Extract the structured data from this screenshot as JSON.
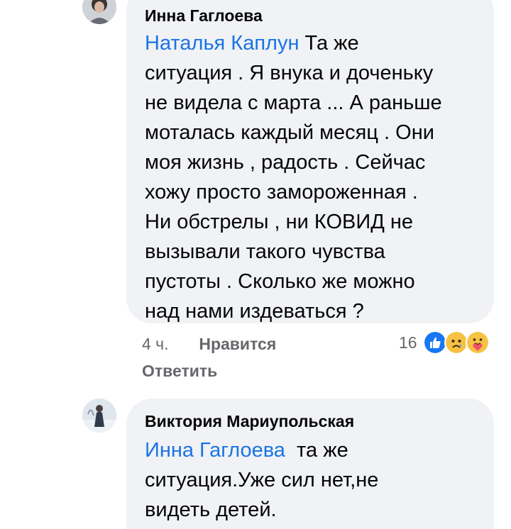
{
  "comments": [
    {
      "author": "Инна Гаглоева",
      "mention": "Наталья Каплун",
      "lines": [
        "Та же",
        "ситуация . Я внука и доченьку",
        "не видела с марта ... А раньше",
        "моталась каждый месяц . Они",
        "моя жизнь , радость . Сейчас",
        "хожу просто замороженная .",
        "Ни обстрелы , ни КОВИД не",
        "вызывали такого чувства",
        "пустоты . Сколько же можно",
        "над нами издеваться ?"
      ],
      "time": "4 ч.",
      "like_label": "Нравится",
      "reply_label": "Ответить",
      "reaction_count": "16",
      "reactions": [
        "like-icon",
        "sad-icon",
        "care-icon"
      ]
    },
    {
      "author": "Виктория Мариупольская",
      "mention": "Инна Гаглоева",
      "lines": [
        "та же",
        "ситуация.Уже сил нет,не",
        "видеть детей."
      ]
    }
  ],
  "colors": {
    "bubble": "#f0f2f5",
    "mention": "#1b74e4",
    "meta": "#65676b",
    "like": "#1877f2",
    "emoji": "#f7c243"
  }
}
